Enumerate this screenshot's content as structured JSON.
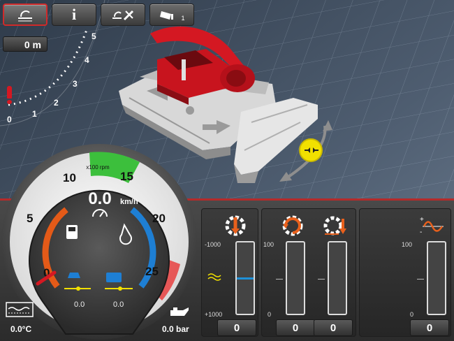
{
  "toolbar": {
    "buttons": [
      {
        "name": "snow-surface-icon",
        "active": true
      },
      {
        "name": "info-icon",
        "label": "i",
        "active": false
      },
      {
        "name": "tools-icon",
        "active": false
      },
      {
        "name": "camera-icon",
        "badge": "1",
        "active": false
      }
    ]
  },
  "distance": {
    "value": "0 m",
    "scale_ticks": [
      "0",
      "1",
      "2",
      "3",
      "4",
      "5"
    ]
  },
  "gauge": {
    "speed_value": "0.0",
    "speed_unit": "km/h",
    "rpm_unit": "x100 rpm",
    "rpm_ticks": [
      "0",
      "5",
      "10",
      "15",
      "20",
      "25"
    ],
    "left_readout": "0.0",
    "right_readout": "0.0"
  },
  "status": {
    "temperature": "0.0°C",
    "oil_pressure": "0.0 bar"
  },
  "controls": {
    "group1": {
      "scale": [
        "-1000",
        "0",
        "+1000"
      ],
      "value": "0"
    },
    "group2": {
      "scale": [
        "100",
        "0"
      ],
      "values": [
        "0",
        "0"
      ]
    },
    "group3": {
      "scale": [
        "100",
        "0"
      ],
      "value": "0"
    }
  },
  "colors": {
    "accent_red": "#d02a2a",
    "vehicle_red": "#c8141e",
    "control_orange": "#e8601c",
    "fuel_orange": "#e45a18",
    "temp_blue": "#1e7fd4",
    "rpm_green": "#3cbf3c",
    "indicator_yellow": "#f2e000",
    "bar_blue": "#1e90d8"
  }
}
